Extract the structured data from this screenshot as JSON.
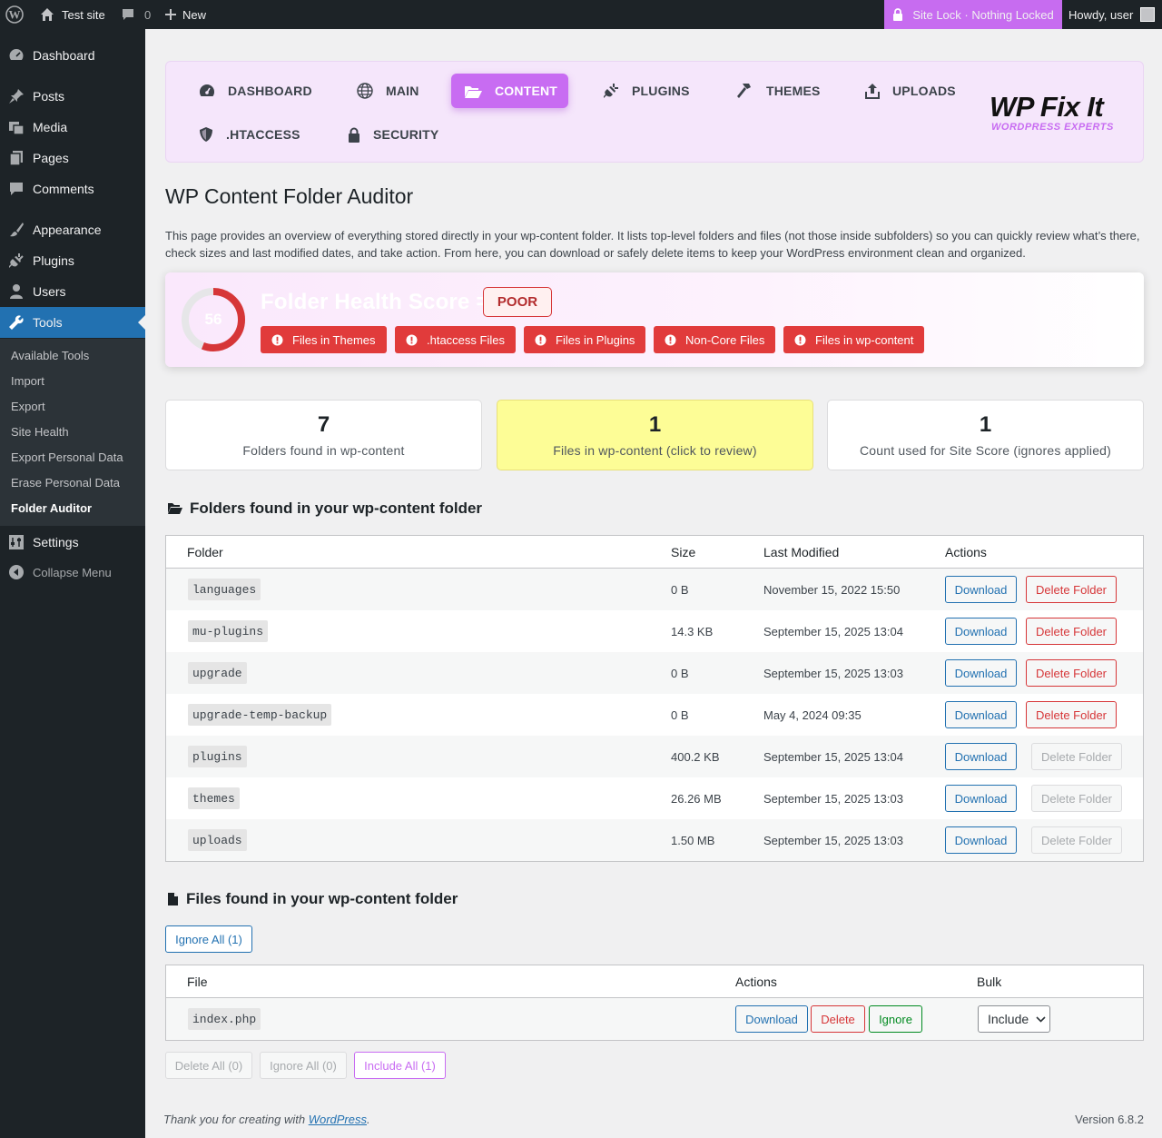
{
  "adminbar": {
    "site_name": "Test site",
    "comments_count": "0",
    "new_label": "New",
    "site_lock": "Site Lock · Nothing Locked",
    "howdy": "Howdy, user"
  },
  "sidebar": {
    "items": [
      {
        "label": "Dashboard",
        "icon": "dashboard-icon"
      },
      {
        "label": "Posts",
        "icon": "pin-icon"
      },
      {
        "label": "Media",
        "icon": "media-icon"
      },
      {
        "label": "Pages",
        "icon": "pages-icon"
      },
      {
        "label": "Comments",
        "icon": "comment-icon"
      },
      {
        "label": "Appearance",
        "icon": "brush-icon"
      },
      {
        "label": "Plugins",
        "icon": "plug-icon"
      },
      {
        "label": "Users",
        "icon": "user-icon"
      },
      {
        "label": "Tools",
        "icon": "wrench-icon"
      },
      {
        "label": "Settings",
        "icon": "settings-icon"
      }
    ],
    "submenu": [
      "Available Tools",
      "Import",
      "Export",
      "Site Health",
      "Export Personal Data",
      "Erase Personal Data",
      "Folder Auditor"
    ],
    "collapse": "Collapse Menu"
  },
  "nav": {
    "tabs": [
      {
        "label": "DASHBOARD",
        "icon": "gauge-icon"
      },
      {
        "label": "MAIN",
        "icon": "globe-icon"
      },
      {
        "label": "CONTENT",
        "icon": "folder-open-icon",
        "active": true
      },
      {
        "label": "PLUGINS",
        "icon": "plug-icon"
      },
      {
        "label": "THEMES",
        "icon": "hammer-icon"
      },
      {
        "label": "UPLOADS",
        "icon": "upload-icon"
      },
      {
        "label": ".HTACCESS",
        "icon": "shield-icon"
      },
      {
        "label": "SECURITY",
        "icon": "lock-icon"
      }
    ],
    "logo_main": "WP Fix It",
    "logo_sub": "WORDPRESS EXPERTS"
  },
  "page": {
    "title": "WP Content Folder Auditor",
    "intro": "This page provides an overview of everything stored directly in your wp-content folder. It lists top-level folders and files (not those inside subfolders) so you can quickly review what’s there, check sizes and last modified dates, and take action. From here, you can download or safely delete items to keep your WordPress environment clean and organized."
  },
  "health": {
    "score": 56,
    "title": "Folder Health Score =",
    "rating": "POOR",
    "warnings": [
      "Files in Themes",
      ".htaccess Files",
      "Files in Plugins",
      "Non-Core Files",
      "Files in wp-content"
    ],
    "color_accent": "#d63638"
  },
  "stats": [
    {
      "value": "7",
      "label": "Folders found in wp-content"
    },
    {
      "value": "1",
      "label": "Files in wp-content (click to review)"
    },
    {
      "value": "1",
      "label": "Count used for Site Score (ignores applied)"
    }
  ],
  "folders": {
    "heading": "Folders found in your wp-content folder",
    "columns": [
      "Folder",
      "Size",
      "Last Modified",
      "Actions"
    ],
    "download_label": "Download",
    "delete_label": "Delete Folder",
    "rows": [
      {
        "name": "languages",
        "size": "0 B",
        "modified": "November 15, 2022 15:50",
        "deletable": true
      },
      {
        "name": "mu-plugins",
        "size": "14.3 KB",
        "modified": "September 15, 2025 13:04",
        "deletable": true
      },
      {
        "name": "upgrade",
        "size": "0 B",
        "modified": "September 15, 2025 13:03",
        "deletable": true
      },
      {
        "name": "upgrade-temp-backup",
        "size": "0 B",
        "modified": "May 4, 2024 09:35",
        "deletable": true
      },
      {
        "name": "plugins",
        "size": "400.2 KB",
        "modified": "September 15, 2025 13:04",
        "deletable": false
      },
      {
        "name": "themes",
        "size": "26.26 MB",
        "modified": "September 15, 2025 13:03",
        "deletable": false
      },
      {
        "name": "uploads",
        "size": "1.50 MB",
        "modified": "September 15, 2025 13:03",
        "deletable": false
      }
    ]
  },
  "files": {
    "heading": "Files found in your wp-content folder",
    "ignore_all_top": "Ignore All (1)",
    "columns": [
      "File",
      "Actions",
      "Bulk"
    ],
    "rows": [
      {
        "name": "index.php",
        "download": "Download",
        "delete": "Delete",
        "ignore": "Ignore",
        "bulk": "Include"
      }
    ],
    "bottom_buttons": [
      "Delete All (0)",
      "Ignore All (0)",
      "Include All (1)"
    ]
  },
  "footer": {
    "thanks_prefix": "Thank you for creating with ",
    "thanks_link": "WordPress",
    "thanks_suffix": ".",
    "version": "Version 6.8.2"
  }
}
